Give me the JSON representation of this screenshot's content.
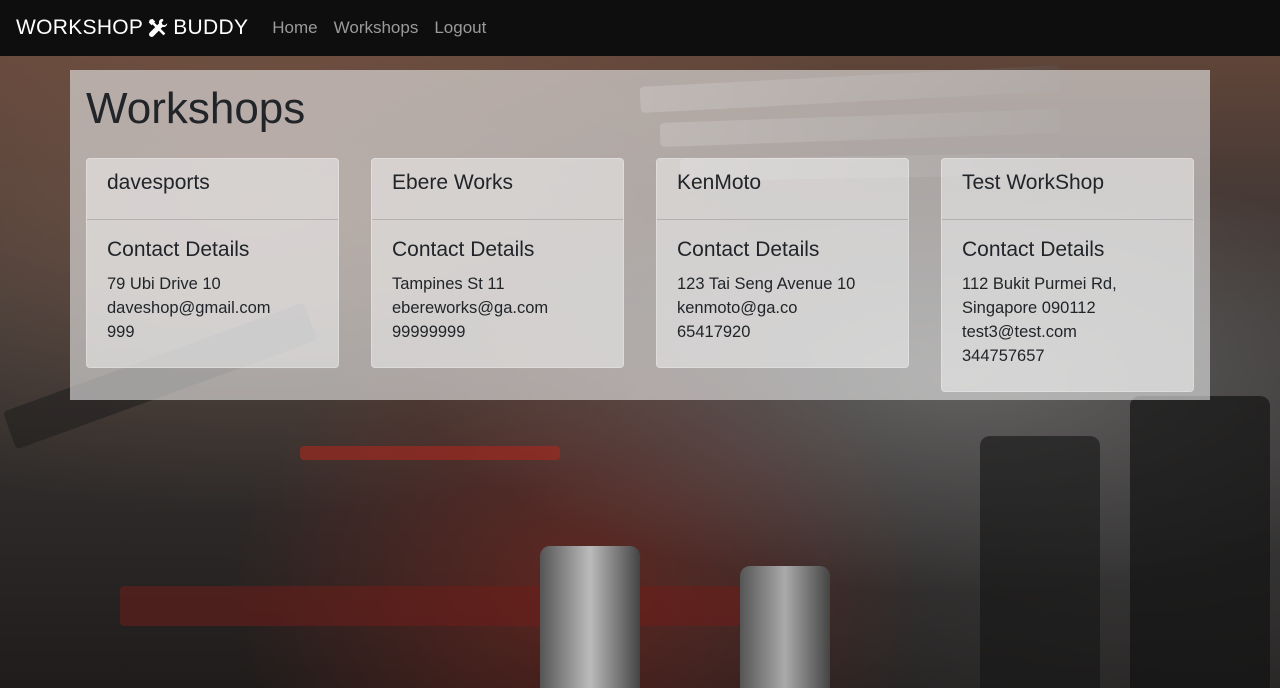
{
  "navbar": {
    "brand_left": "WORKSHOP",
    "brand_right": "BUDDY",
    "brand_icon": "wrench-screwdriver-icon",
    "links": [
      "Home",
      "Workshops",
      "Logout"
    ]
  },
  "page": {
    "title": "Workshops"
  },
  "workshops": [
    {
      "name": "davesports",
      "section_label": "Contact Details",
      "address_lines": [
        "79 Ubi Drive 10"
      ],
      "email": "daveshop@gmail.com",
      "phone": "999"
    },
    {
      "name": "Ebere Works",
      "section_label": "Contact Details",
      "address_lines": [
        "Tampines St 11"
      ],
      "email": "ebereworks@ga.com",
      "phone": "99999999"
    },
    {
      "name": "KenMoto",
      "section_label": "Contact Details",
      "address_lines": [
        "123 Tai Seng Avenue 10"
      ],
      "email": "kenmoto@ga.co",
      "phone": "65417920"
    },
    {
      "name": "Test WorkShop",
      "section_label": "Contact Details",
      "address_lines": [
        "112 Bukit Purmei Rd,",
        "Singapore 090112"
      ],
      "email": "test3@test.com",
      "phone": "344757657"
    }
  ]
}
